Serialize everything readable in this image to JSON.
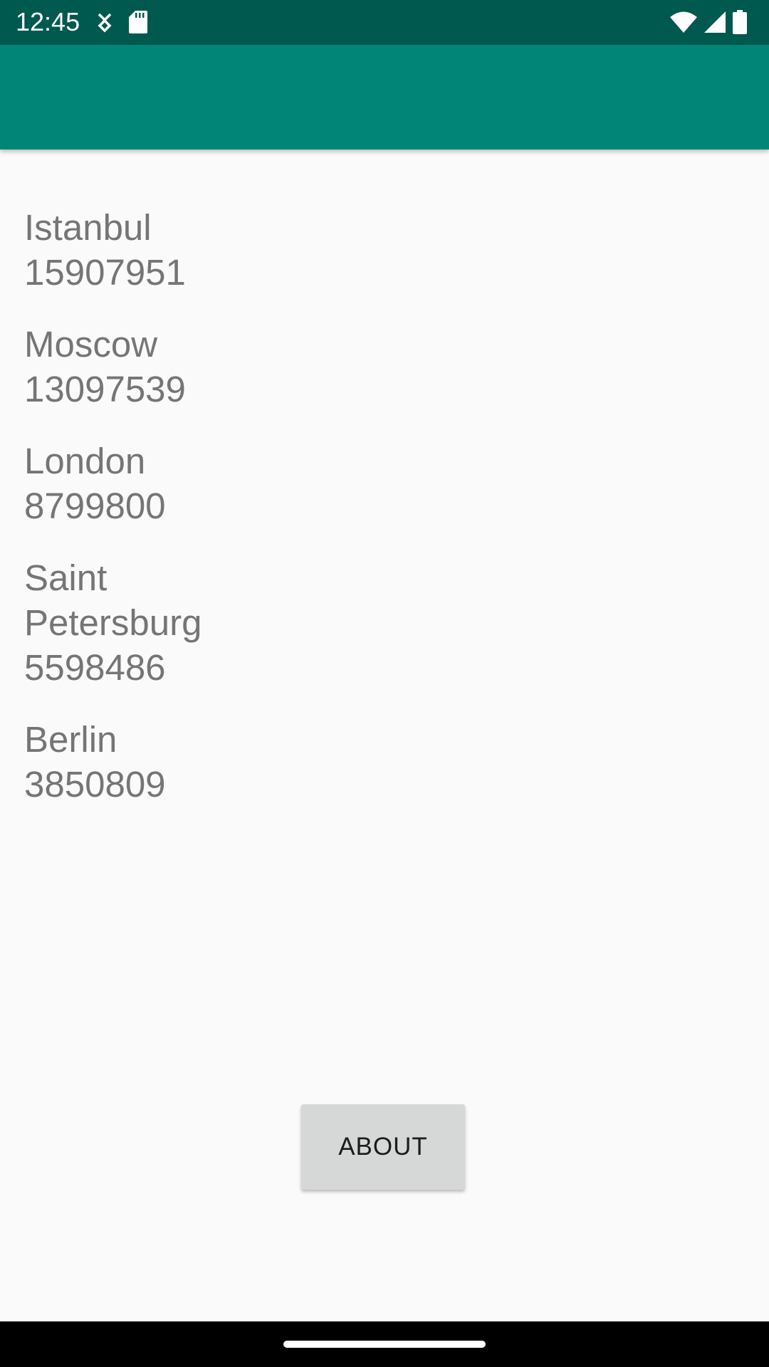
{
  "status_bar": {
    "time": "12:45",
    "left_icons": [
      "data-saver-icon",
      "sd-card-icon"
    ],
    "right_icons": [
      "wifi-icon",
      "cell-signal-icon",
      "battery-icon"
    ],
    "background_color": "#00594f"
  },
  "app_bar": {
    "background_color": "#008577"
  },
  "cities": [
    {
      "name": "Istanbul",
      "population": "15907951"
    },
    {
      "name": "Moscow",
      "population": "13097539"
    },
    {
      "name": "London",
      "population": "8799800"
    },
    {
      "name": "Saint Petersburg",
      "population": "5598486"
    },
    {
      "name": "Berlin",
      "population": "3850809"
    }
  ],
  "about_button": {
    "label": "ABOUT"
  }
}
